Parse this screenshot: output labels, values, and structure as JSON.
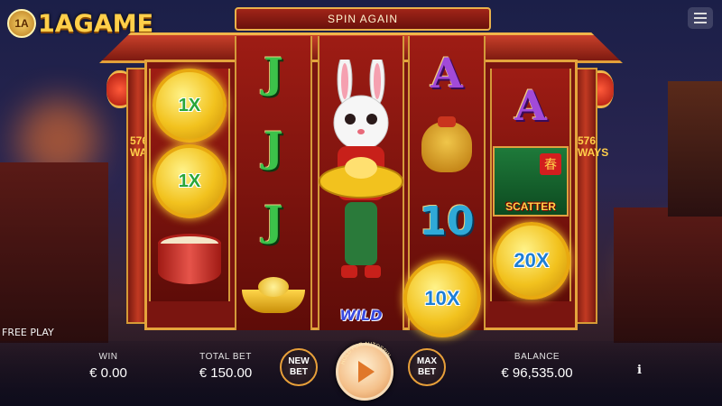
{
  "logo": {
    "badge": "1A",
    "text": "1AGAME"
  },
  "header": {
    "spin_again": "SPIN AGAIN"
  },
  "side_label": "576 WAYS",
  "reels": {
    "reel1": [
      {
        "kind": "coin",
        "text": "1X"
      },
      {
        "kind": "coin",
        "text": "1X"
      },
      {
        "kind": "drum",
        "text": ""
      }
    ],
    "reel2": [
      {
        "kind": "letter",
        "text": "J"
      },
      {
        "kind": "letter",
        "text": "J"
      },
      {
        "kind": "letter",
        "text": "J"
      },
      {
        "kind": "ingot",
        "text": ""
      }
    ],
    "reel3": {
      "wild_label": "WILD"
    },
    "reel4": [
      {
        "kind": "letter",
        "text": "A"
      },
      {
        "kind": "bag",
        "text": ""
      },
      {
        "kind": "ten",
        "text": "10"
      },
      {
        "kind": "coin",
        "text": "10X"
      }
    ],
    "reel5": [
      {
        "kind": "letter",
        "text": "A"
      },
      {
        "kind": "scatter",
        "text": "SCATTER",
        "mark": "春"
      },
      {
        "kind": "coin",
        "text": "20X"
      }
    ]
  },
  "free_play": "FREE PLAY",
  "bottom": {
    "win_label": "WIN",
    "win_value": "€ 0.00",
    "total_bet_label": "TOTAL BET",
    "total_bet_value": "€ 150.00",
    "new_bet": "NEW BET",
    "max_bet": "MAX BET",
    "hold_for_autospin": "HOLD FOR AUTOSPIN",
    "balance_label": "BALANCE",
    "balance_value": "€ 96,535.00",
    "info": "i"
  },
  "colors": {
    "gold": "#f2c21e",
    "frame_red": "#7a1510",
    "accent": "#e8a03a"
  }
}
